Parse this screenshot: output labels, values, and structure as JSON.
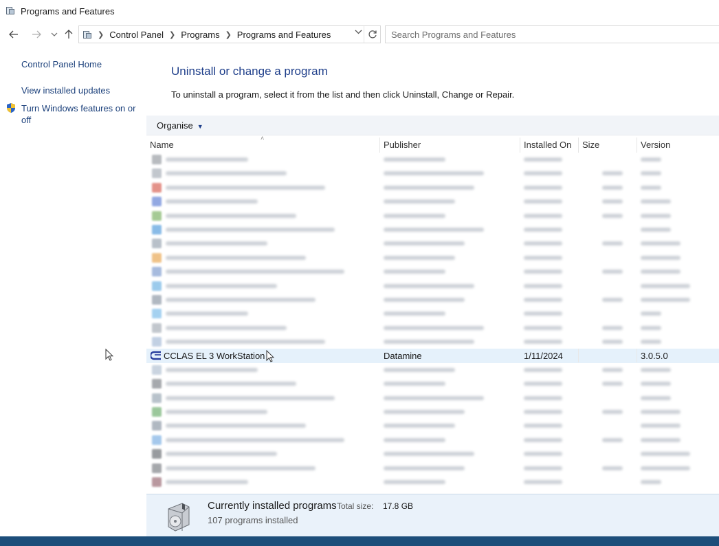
{
  "window": {
    "title": "Programs and Features"
  },
  "navigation": {
    "breadcrumbs": [
      "Control Panel",
      "Programs",
      "Programs and Features"
    ],
    "search_placeholder": "Search Programs and Features"
  },
  "sidebar": {
    "home_link": "Control Panel Home",
    "updates_link": "View installed updates",
    "features_link_line1": "Turn Windows features on or",
    "features_link_line2": "off"
  },
  "main": {
    "heading": "Uninstall or change a program",
    "instructions": "To uninstall a program, select it from the list and then click Uninstall, Change or Repair.",
    "organise_label": "Organise"
  },
  "columns": {
    "name": "Name",
    "publisher": "Publisher",
    "installed_on": "Installed On",
    "size": "Size",
    "version": "Version"
  },
  "program_list": {
    "rows_before_selected": 14,
    "rows_after_selected": 9,
    "selected_program": {
      "name": "CCLAS EL 3 WorkStation",
      "publisher": "Datamine",
      "installed_on": "1/11/2024",
      "size": "",
      "version": "3.0.5.0"
    }
  },
  "details": {
    "title": "Currently installed programs",
    "total_size_label": "Total size:",
    "total_size_value": "17.8 GB",
    "count_text": "107 programs installed"
  },
  "colors": {
    "heading_blue": "#1e3e8a",
    "link_blue": "#1a3f7a",
    "selection": "#e5f1fb",
    "details_bg": "#eaf2fa",
    "taskbar": "#1d4e7a"
  }
}
